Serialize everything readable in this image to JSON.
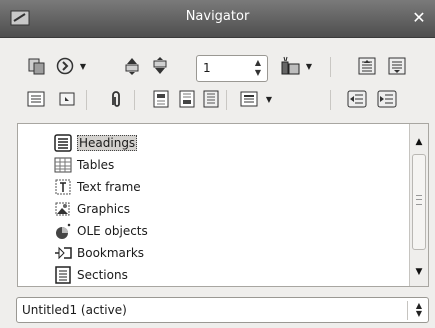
{
  "window": {
    "title": "Navigator"
  },
  "toolbar": {
    "page_number": "1"
  },
  "content_types": [
    {
      "label": "Headings",
      "icon": "headings-icon",
      "selected": true
    },
    {
      "label": "Tables",
      "icon": "table-icon",
      "selected": false
    },
    {
      "label": "Text frame",
      "icon": "text-frame-icon",
      "selected": false
    },
    {
      "label": "Graphics",
      "icon": "graphics-icon",
      "selected": false
    },
    {
      "label": "OLE objects",
      "icon": "ole-object-icon",
      "selected": false
    },
    {
      "label": "Bookmarks",
      "icon": "bookmark-icon",
      "selected": false
    },
    {
      "label": "Sections",
      "icon": "section-icon",
      "selected": false
    }
  ],
  "document_select": {
    "value": "Untitled1 (active)"
  },
  "colors": {
    "titlebar": "#5a5a5a",
    "background": "#efeeec",
    "list_bg": "#ffffff",
    "selection": "#d4d2cf"
  }
}
